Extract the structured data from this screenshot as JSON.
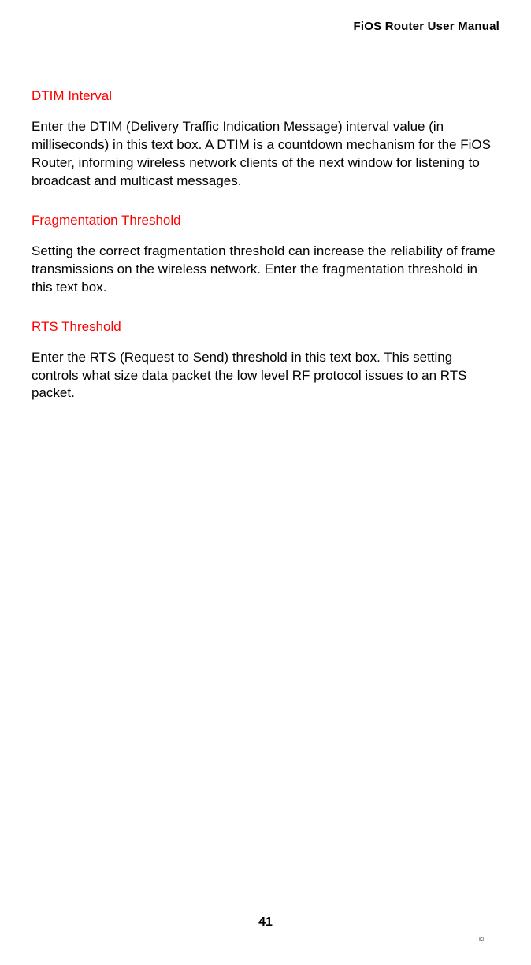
{
  "header": {
    "title": "FiOS Router User Manual"
  },
  "sections": [
    {
      "heading": "DTIM Interval",
      "body": "Enter the DTIM (Delivery Traffic Indication Message) interval value (in milliseconds) in this text box. A DTIM is a countdown mechanism for the FiOS Router, informing wireless network clients of the next window for listening to broadcast and multicast messages."
    },
    {
      "heading": "Fragmentation Threshold",
      "body": "Setting the correct fragmentation threshold can increase the reliability of frame transmissions on the wireless network. Enter the fragmentation threshold in this text box."
    },
    {
      "heading": "RTS Threshold",
      "body": "Enter the RTS (Request to Send) threshold in this text box. This setting controls what size data packet the low level RF protocol issues to an RTS packet."
    }
  ],
  "footer": {
    "page_number": "41",
    "copyright": "©"
  }
}
